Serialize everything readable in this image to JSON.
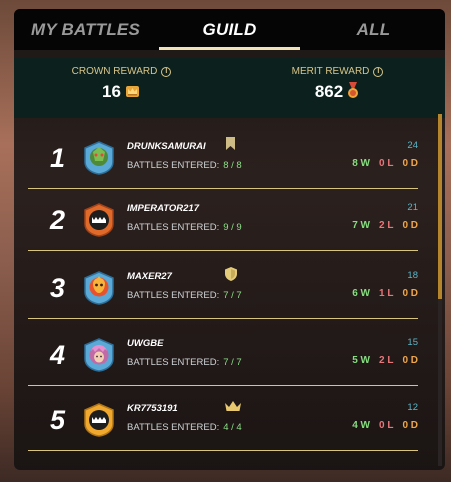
{
  "tabs": [
    {
      "label": "MY BATTLES",
      "active": false
    },
    {
      "label": "GUILD",
      "active": true
    },
    {
      "label": "ALL",
      "active": false
    }
  ],
  "rewards": {
    "crown": {
      "label": "CROWN REWARD",
      "value": "16",
      "icon": "crown-token-icon"
    },
    "merit": {
      "label": "MERIT REWARD",
      "value": "862",
      "icon": "merit-medal-icon"
    }
  },
  "entered_label": "BATTLES ENTERED:",
  "players": [
    {
      "rank": "1",
      "name": "DRUNKSAMURAI",
      "entered": "8 / 8",
      "score": "24",
      "wins": "8 W",
      "losses": "0 L",
      "draws": "0 D",
      "badge": "bookmark-icon",
      "avatar": "plant-warrior-avatar"
    },
    {
      "rank": "2",
      "name": "IMPERATOR217",
      "entered": "9 / 9",
      "score": "21",
      "wins": "7 W",
      "losses": "2 L",
      "draws": "0 D",
      "badge": "",
      "avatar": "monster-mouth-avatar"
    },
    {
      "rank": "3",
      "name": "MAXER27",
      "entered": "7 / 7",
      "score": "18",
      "wins": "6 W",
      "losses": "1 L",
      "draws": "0 D",
      "badge": "shield-icon",
      "avatar": "fire-creature-avatar"
    },
    {
      "rank": "4",
      "name": "UWGBE",
      "entered": "7 / 7",
      "score": "15",
      "wins": "5 W",
      "losses": "2 L",
      "draws": "0 D",
      "badge": "",
      "avatar": "pink-hair-avatar"
    },
    {
      "rank": "5",
      "name": "KR7753191",
      "entered": "4 / 4",
      "score": "12",
      "wins": "4 W",
      "losses": "0 L",
      "draws": "0 D",
      "badge": "crown-icon",
      "avatar": "gold-monster-avatar"
    }
  ],
  "colors": {
    "accent": "#f1e3b8",
    "win": "#86dd80",
    "loss": "#e7777b",
    "draw": "#f0a64a",
    "score": "#5fb4c5"
  }
}
